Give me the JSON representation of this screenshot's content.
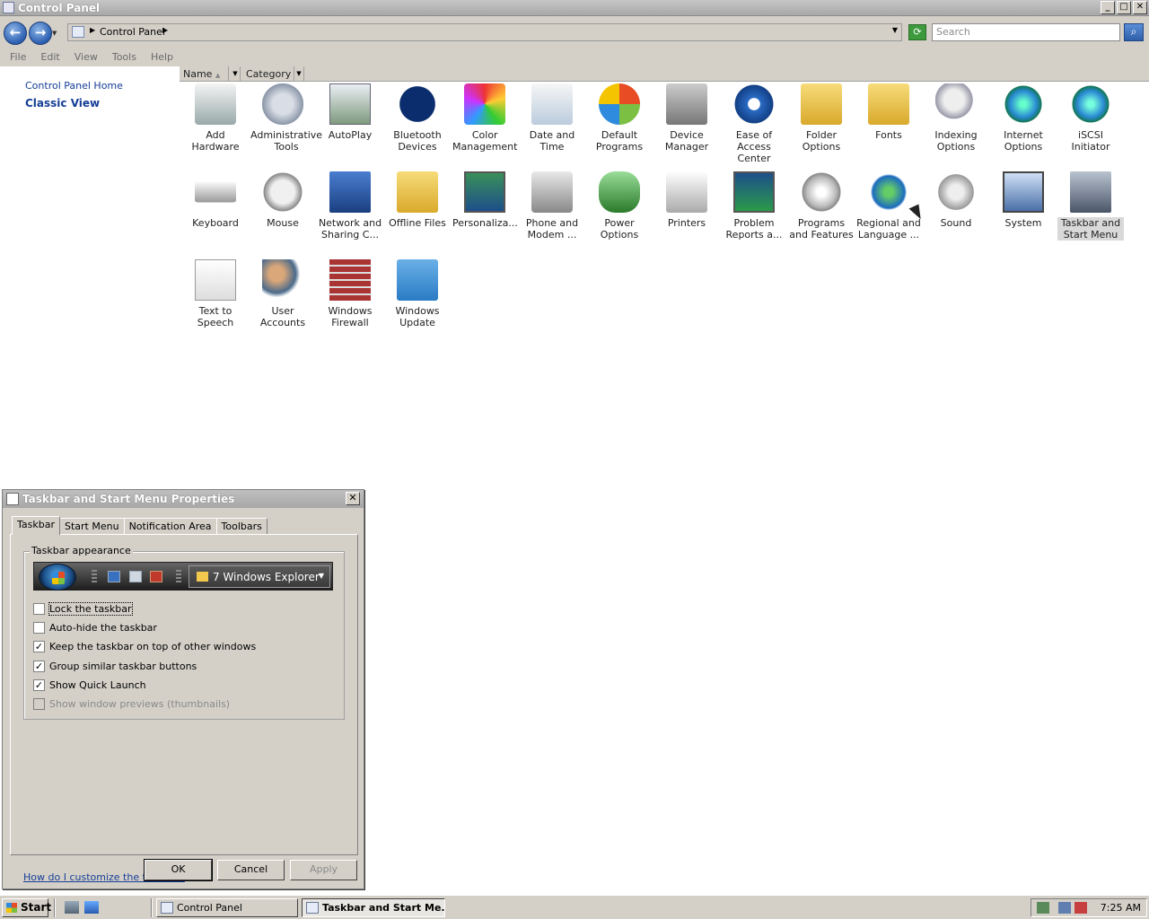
{
  "window": {
    "title": "Control Panel",
    "min_glyph": "_",
    "max_glyph": "□",
    "close_glyph": "✕"
  },
  "address": {
    "path": "Control Panel",
    "search_placeholder": "Search"
  },
  "menu": [
    "File",
    "Edit",
    "View",
    "Tools",
    "Help"
  ],
  "sidebar": {
    "home_link": "Control Panel Home",
    "classic_view": "Classic View"
  },
  "columns": {
    "name": "Name",
    "category": "Category"
  },
  "items": [
    {
      "label": "Add Hardware",
      "icon": "add-hardware-icon"
    },
    {
      "label": "Administrative Tools",
      "icon": "administrative-tools-icon"
    },
    {
      "label": "AutoPlay",
      "icon": "autoplay-icon"
    },
    {
      "label": "Bluetooth Devices",
      "icon": "bluetooth-icon"
    },
    {
      "label": "Color Management",
      "icon": "color-management-icon"
    },
    {
      "label": "Date and Time",
      "icon": "date-time-icon"
    },
    {
      "label": "Default Programs",
      "icon": "default-programs-icon"
    },
    {
      "label": "Device Manager",
      "icon": "device-manager-icon"
    },
    {
      "label": "Ease of Access Center",
      "icon": "ease-of-access-icon"
    },
    {
      "label": "Folder Options",
      "icon": "folder-options-icon"
    },
    {
      "label": "Fonts",
      "icon": "fonts-icon"
    },
    {
      "label": "Indexing Options",
      "icon": "indexing-options-icon"
    },
    {
      "label": "Internet Options",
      "icon": "internet-options-icon"
    },
    {
      "label": "iSCSI Initiator",
      "icon": "iscsi-initiator-icon"
    },
    {
      "label": "Keyboard",
      "icon": "keyboard-icon"
    },
    {
      "label": "Mouse",
      "icon": "mouse-icon"
    },
    {
      "label": "Network and Sharing C...",
      "icon": "network-sharing-icon"
    },
    {
      "label": "Offline Files",
      "icon": "offline-files-icon"
    },
    {
      "label": "Personaliza...",
      "icon": "personalization-icon"
    },
    {
      "label": "Phone and Modem ...",
      "icon": "phone-modem-icon"
    },
    {
      "label": "Power Options",
      "icon": "power-options-icon"
    },
    {
      "label": "Printers",
      "icon": "printers-icon"
    },
    {
      "label": "Problem Reports a...",
      "icon": "problem-reports-icon"
    },
    {
      "label": "Programs and Features",
      "icon": "programs-features-icon"
    },
    {
      "label": "Regional and Language ...",
      "icon": "regional-language-icon"
    },
    {
      "label": "Sound",
      "icon": "sound-icon"
    },
    {
      "label": "System",
      "icon": "system-icon"
    },
    {
      "label": "Taskbar and Start Menu",
      "icon": "taskbar-start-menu-icon",
      "selected": true
    },
    {
      "label": "Text to Speech",
      "icon": "text-to-speech-icon"
    },
    {
      "label": "User Accounts",
      "icon": "user-accounts-icon"
    },
    {
      "label": "Windows Firewall",
      "icon": "windows-firewall-icon"
    },
    {
      "label": "Windows Update",
      "icon": "windows-update-icon"
    }
  ],
  "dialog": {
    "title": "Taskbar and Start Menu Properties",
    "close_glyph": "✕",
    "tabs": [
      "Taskbar",
      "Start Menu",
      "Notification Area",
      "Toolbars"
    ],
    "active_tab": "Taskbar",
    "group_title": "Taskbar appearance",
    "preview_task": "7 Windows Explorer",
    "options": [
      {
        "label": "Lock the taskbar",
        "checked": false,
        "enabled": true
      },
      {
        "label": "Auto-hide the taskbar",
        "checked": false,
        "enabled": true
      },
      {
        "label": "Keep the taskbar on top of other windows",
        "checked": true,
        "enabled": true
      },
      {
        "label": "Group similar taskbar buttons",
        "checked": true,
        "enabled": true
      },
      {
        "label": "Show Quick Launch",
        "checked": true,
        "enabled": true
      },
      {
        "label": "Show window previews (thumbnails)",
        "checked": false,
        "enabled": false
      }
    ],
    "help_link": "How do I customize the taskbar?",
    "buttons": {
      "ok": "OK",
      "cancel": "Cancel",
      "apply": "Apply"
    }
  },
  "taskbar": {
    "start": "Start",
    "tasks": [
      "Control Panel",
      "Taskbar and Start Me..."
    ],
    "active_task": "Taskbar and Start Me...",
    "clock": "7:25 AM"
  }
}
